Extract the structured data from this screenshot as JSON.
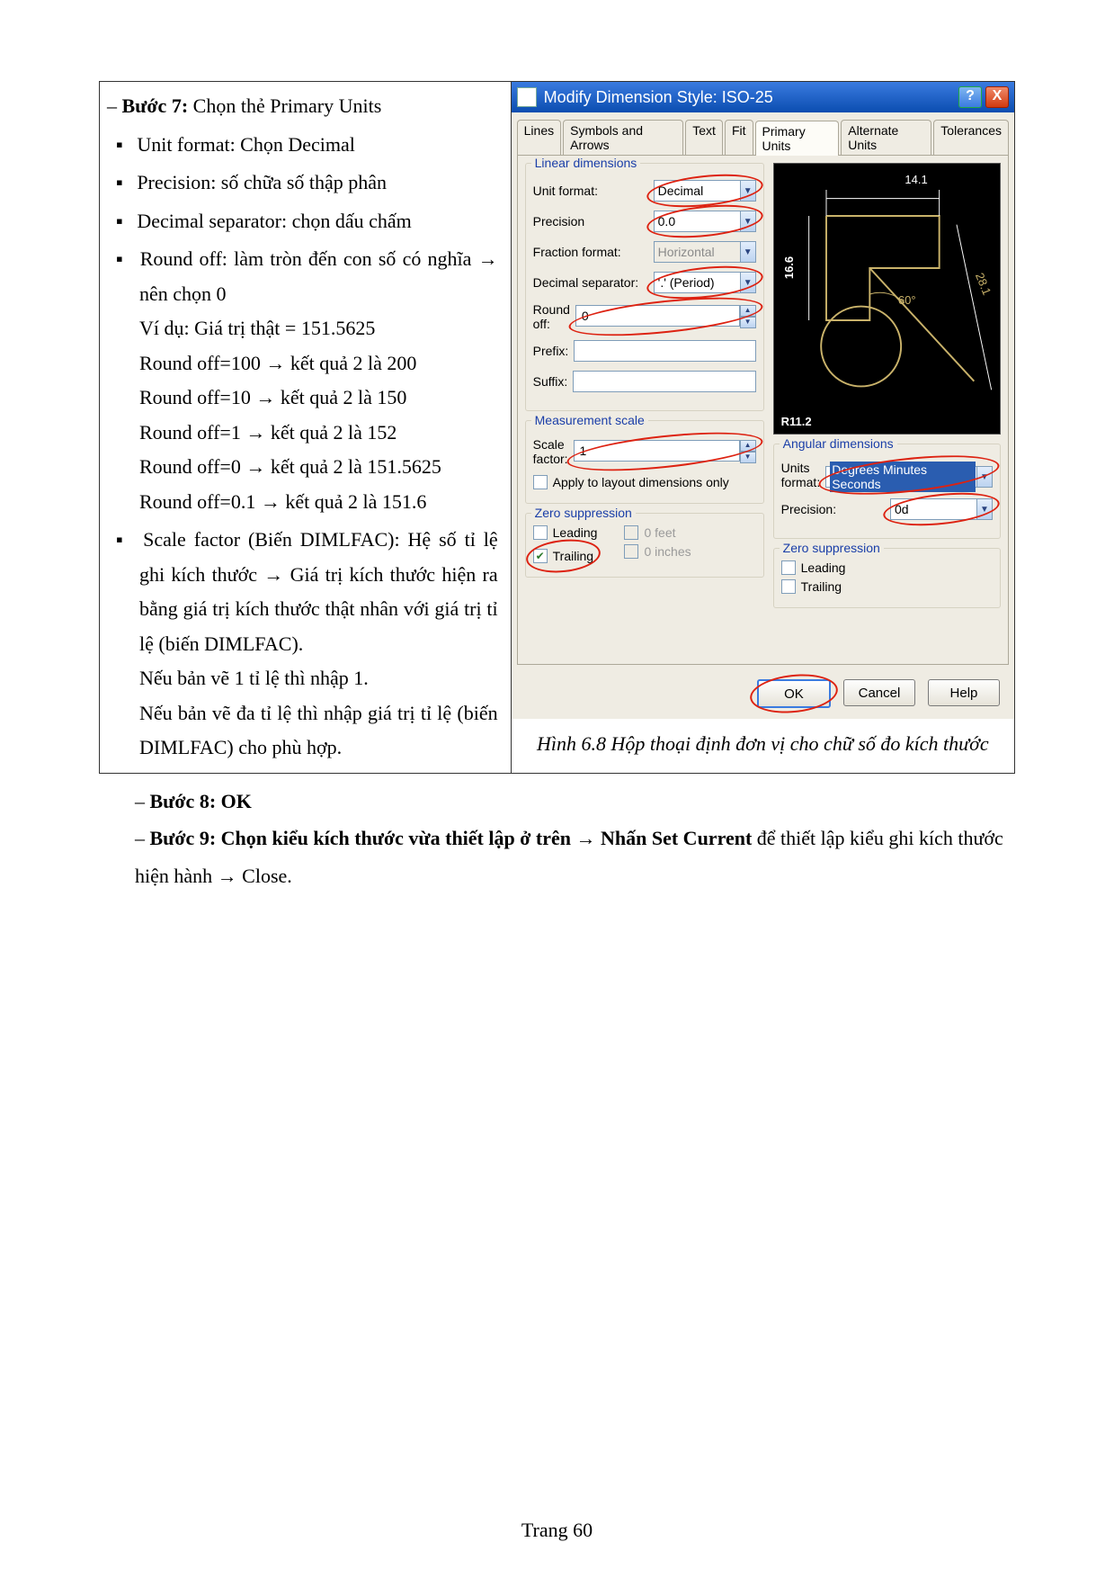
{
  "doc": {
    "step7_lead": "Bước 7:",
    "step7_tail": " Chọn thẻ Primary Units",
    "b1": "Unit format: Chọn Decimal",
    "b2": "Precision: số chữa số thập phân",
    "b3": "Decimal separator: chọn dấu chấm",
    "b4a": "Round off: làm tròn đến con số có nghĩa ",
    "arrow": "→",
    "b4b": " nên chọn 0",
    "b4c": "Ví dụ: Giá trị thật = 151.5625",
    "b4d1a": "Round off=100 ",
    "b4d1b": " kết quả 2 là 200",
    "b4d2a": "Round off=10 ",
    "b4d2b": " kết quả 2 là 150",
    "b4d3a": "Round off=1 ",
    "b4d3b": " kết quả 2 là 152",
    "b4d4a": "Round off=0 ",
    "b4d4b": " kết quả 2 là 151.5625",
    "b4d5a": "Round off=0.1 ",
    "b4d5b": " kết quả 2 là 151.6",
    "b5a": "Scale factor (Biến DIMLFAC): Hệ số tỉ lệ ghi kích thước ",
    "b5b": " Giá trị kích thước hiện ra bằng giá trị kích thước thật nhân với giá trị tỉ lệ (biến DIMLFAC).",
    "b5c": "Nếu bản vẽ 1 tỉ lệ thì nhập 1.",
    "b5d": "Nếu bản vẽ đa tỉ lệ thì nhập giá trị tỉ lệ (biến DIMLFAC) cho phù hợp.",
    "step8": "Bước 8: OK",
    "step9a": "Bước 9: Chọn kiểu kích thước vừa thiết lập ở trên ",
    "step9b": " Nhấn Set Current",
    "step9c": " để thiết lập kiểu ghi kích thước hiện hành ",
    "step9d": " Close.",
    "caption": "Hình 6.8 Hộp thoại định đơn vị cho chữ số đo kích thước",
    "footer": "Trang 60"
  },
  "dlg": {
    "title": "Modify Dimension Style: ISO-25",
    "tabs": [
      "Lines",
      "Symbols and Arrows",
      "Text",
      "Fit",
      "Primary Units",
      "Alternate Units",
      "Tolerances"
    ],
    "linear_legend": "Linear dimensions",
    "unit_format_lbl": "Unit format:",
    "unit_format_val": "Decimal",
    "precision_lbl": "Precision",
    "precision_val": "0.0",
    "fraction_lbl": "Fraction format:",
    "fraction_val": "Horizontal",
    "decsep_lbl": "Decimal separator:",
    "decsep_val": "'.' (Period)",
    "round_lbl": "Round off:",
    "round_val": "0",
    "prefix_lbl": "Prefix:",
    "prefix_val": "",
    "suffix_lbl": "Suffix:",
    "suffix_val": "",
    "meas_legend": "Measurement scale",
    "scale_lbl": "Scale factor:",
    "scale_val": "1",
    "apply_lbl": "Apply to layout dimensions only",
    "zero_legend": "Zero suppression",
    "leading": "Leading",
    "trailing": "Trailing",
    "feet": "0 feet",
    "inches": "0 inches",
    "ang_legend": "Angular dimensions",
    "ang_units_lbl": "Units format:",
    "ang_units_val": "Degrees Minutes Seconds",
    "ang_prec_lbl": "Precision:",
    "ang_prec_val": "0d",
    "zero2_legend": "Zero suppression",
    "ok": "OK",
    "cancel": "Cancel",
    "help": "Help",
    "preview": {
      "d1": "14.1",
      "d2": "28.1",
      "d3": "60°",
      "d4": "R11.2",
      "d5": "16.6"
    }
  }
}
